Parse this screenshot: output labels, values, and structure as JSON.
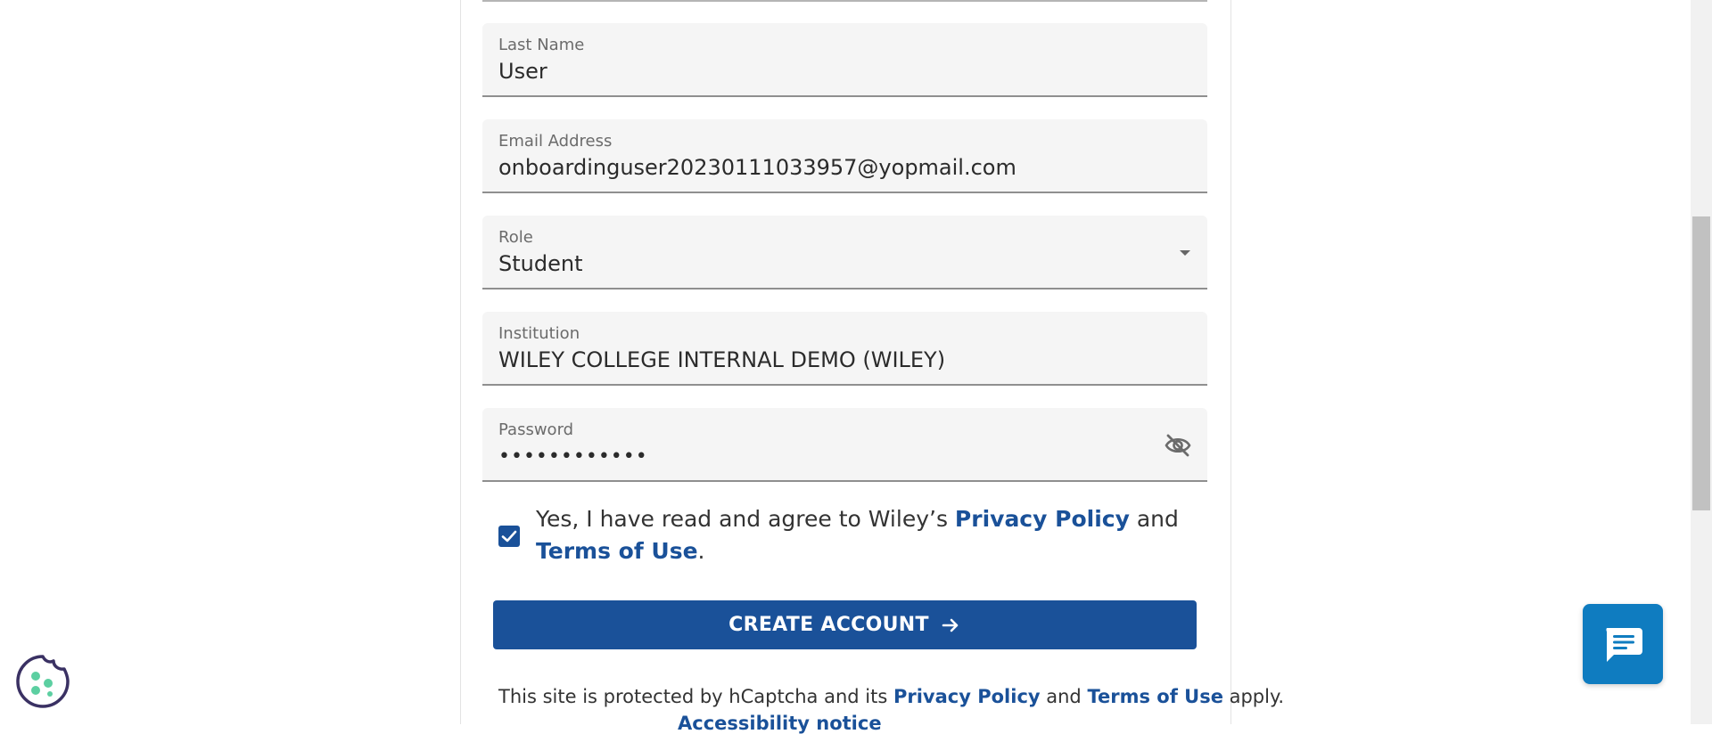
{
  "form": {
    "last_name": {
      "label": "Last Name",
      "value": "User"
    },
    "email": {
      "label": "Email Address",
      "value": "onboardinguser20230111033957@yopmail.com"
    },
    "role": {
      "label": "Role",
      "value": "Student"
    },
    "institution": {
      "label": "Institution",
      "value": "WILEY COLLEGE INTERNAL DEMO (WILEY)"
    },
    "password": {
      "label": "Password",
      "value": "••••••••••••"
    },
    "agreement": {
      "checked": true,
      "prefix": "Yes, I have read and agree to Wiley’s ",
      "privacy_link": "Privacy Policy",
      "middle": " and ",
      "terms_link": "Terms of Use",
      "suffix": "."
    },
    "submit_label": "CREATE ACCOUNT"
  },
  "captcha_notice": {
    "prefix": "This site is protected by hCaptcha and its ",
    "privacy_link": "Privacy Policy",
    "middle": " and ",
    "terms_link": "Terms of Use",
    "suffix": " apply.",
    "next_line_partial": "Accessibility notice"
  },
  "colors": {
    "primary": "#1a5199",
    "chat": "#0f7cc0",
    "field_bg": "#f5f5f5"
  },
  "icons": {
    "password_toggle": "eye-off-icon",
    "dropdown": "chevron-down-icon",
    "submit": "arrow-right-icon",
    "chat": "chat-bubble-icon",
    "cookie": "cookie-icon"
  }
}
